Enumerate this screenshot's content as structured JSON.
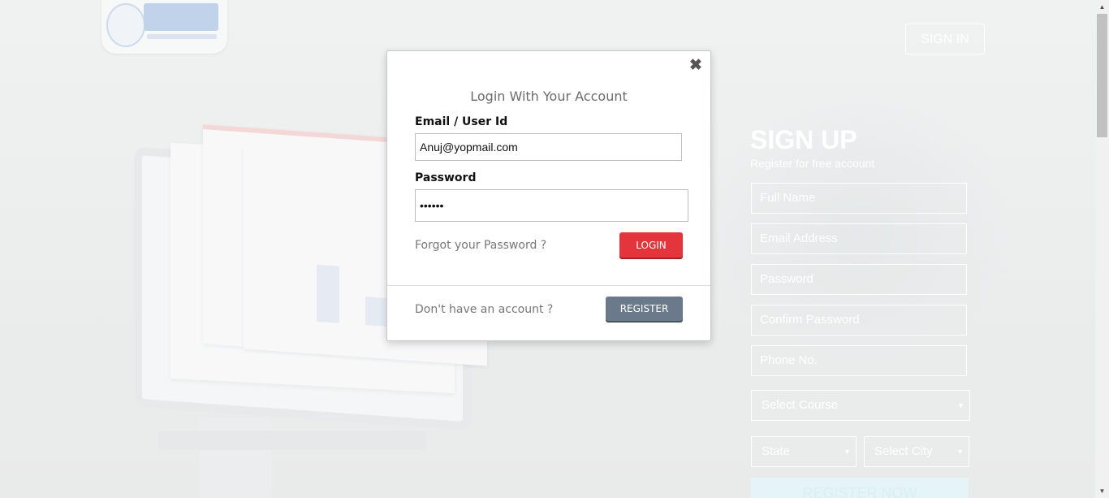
{
  "header": {
    "signin_label": "SIGN IN"
  },
  "signup": {
    "title": "SIGN UP",
    "subtitle": "Register for free account",
    "fields": {
      "full_name": "Full Name",
      "email": "Email Address",
      "password": "Password",
      "confirm_password": "Confirm Password",
      "phone": "Phone No.",
      "course": "Select Course",
      "state": "State",
      "city": "Select City"
    },
    "register_label": "REGISTER NOW"
  },
  "modal": {
    "title": "Login With Your Account",
    "close_glyph": "✖",
    "email_label": "Email / User Id",
    "email_value": "Anuj@yopmail.com",
    "password_label": "Password",
    "password_value": "••••••",
    "forgot_label": "Forgot your Password ?",
    "login_label": "LOGIN",
    "no_account_label": "Don't have an account ?",
    "register_label": "REGISTER"
  },
  "colors": {
    "login_button": "#e3353b",
    "register_button": "#6b7a8a"
  },
  "icons": {
    "close": "close-icon",
    "caret": "caret-down-icon"
  }
}
